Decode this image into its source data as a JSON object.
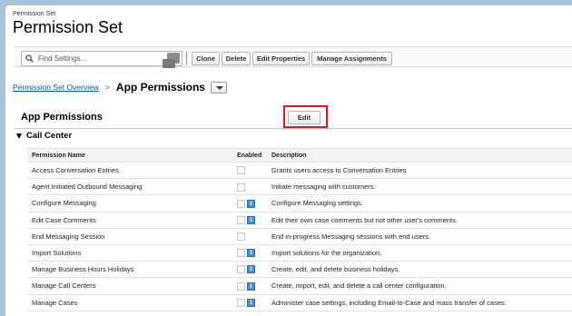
{
  "header": {
    "small_label": "Permission Set",
    "title": "Permission Set"
  },
  "toolbar": {
    "search_placeholder": "Find Settings...",
    "clone_label": "Clone",
    "delete_label": "Delete",
    "edit_properties_label": "Edit Properties",
    "manage_assignments_label": "Manage Assignments"
  },
  "breadcrumb": {
    "link_label": "Permission Set Overview",
    "separator": ">",
    "current": "App Permissions"
  },
  "section": {
    "title": "App Permissions",
    "edit_label": "Edit",
    "subsection": "Call Center"
  },
  "table": {
    "headers": {
      "name": "Permission Name",
      "enabled": "Enabled",
      "description": "Description"
    },
    "rows": [
      {
        "name": "Access Conversation Entries",
        "enabled": false,
        "info": false,
        "description": "Grants users access to Conversation Entries"
      },
      {
        "name": "Agent Initiated Outbound Messaging",
        "enabled": false,
        "info": false,
        "description": "Initiate messaging with customers."
      },
      {
        "name": "Configure Messaging",
        "enabled": false,
        "info": true,
        "description": "Configure Messaging settings."
      },
      {
        "name": "Edit Case Comments",
        "enabled": false,
        "info": true,
        "description": "Edit their own case comments but not other user's comments."
      },
      {
        "name": "End Messaging Session",
        "enabled": false,
        "info": false,
        "description": "End in-progress Messaging sessions with end users."
      },
      {
        "name": "Import Solutions",
        "enabled": false,
        "info": true,
        "description": "Import solutions for the organization."
      },
      {
        "name": "Manage Business Hours Holidays",
        "enabled": false,
        "info": true,
        "description": "Create, edit, and delete business holidays."
      },
      {
        "name": "Manage Call Centers",
        "enabled": false,
        "info": true,
        "description": "Create, import, edit, and delete a call center configuration."
      },
      {
        "name": "Manage Cases",
        "enabled": false,
        "info": true,
        "description": "Administer case settings, including Email-to-Case and mass transfer of cases."
      }
    ]
  },
  "colors": {
    "highlight": "#e8141b",
    "link": "#015ba7",
    "info_icon": "#4d8dd2",
    "background": "#a9c3dd"
  },
  "icons": {
    "search": "search-icon",
    "clear": "clear-search-icon",
    "dropdown": "chevron-down-icon",
    "info": "info-icon",
    "collapse": "collapse-triangle-icon"
  }
}
